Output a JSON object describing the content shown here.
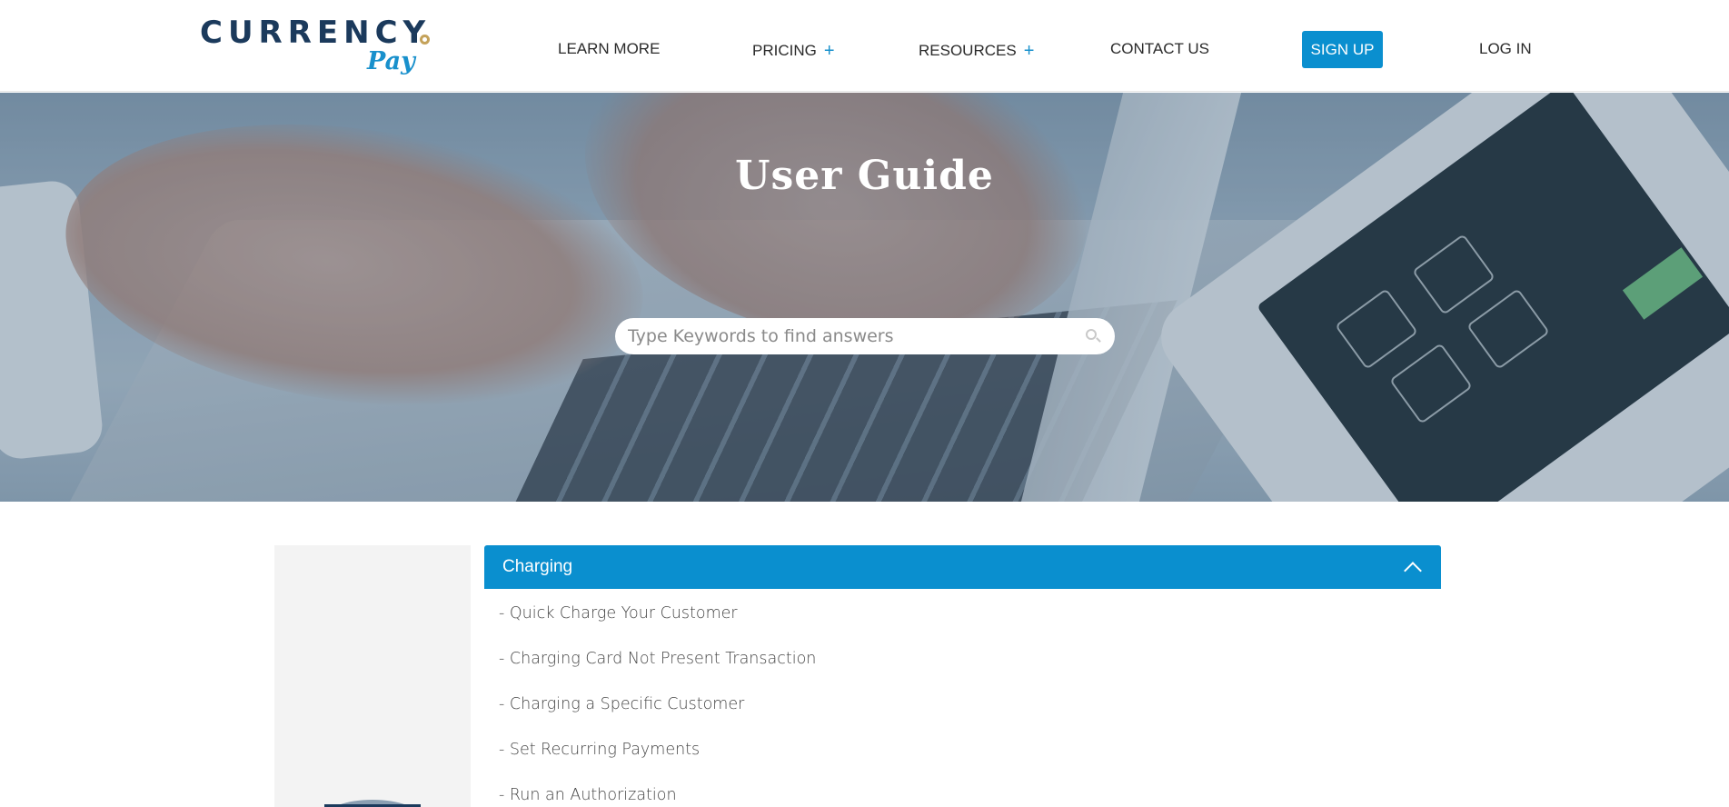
{
  "brand": {
    "logo_main": "CURRENCY",
    "logo_sub": "Pay",
    "colors": {
      "primary": "#0a8fcf",
      "navy": "#1b3a5c",
      "gold": "#c4a25a"
    }
  },
  "nav": {
    "learn_more": "LEARN MORE",
    "pricing": "PRICING",
    "resources": "RESOURCES",
    "plus": "+",
    "contact_us": "CONTACT US",
    "sign_up": "SIGN UP",
    "log_in": "LOG IN"
  },
  "hero": {
    "title": "User Guide",
    "search_placeholder": "Type Keywords to find answers"
  },
  "accordion": {
    "title": "Charging",
    "expanded": true,
    "links": [
      "- Quick Charge Your Customer",
      "- Charging Card Not Present Transaction",
      "- Charging a Specific Customer",
      "- Set Recurring Payments",
      "- Run an Authorization"
    ]
  },
  "icons": {
    "search": "search-icon",
    "chevron": "chevron-up-icon",
    "plus": "plus-icon"
  }
}
